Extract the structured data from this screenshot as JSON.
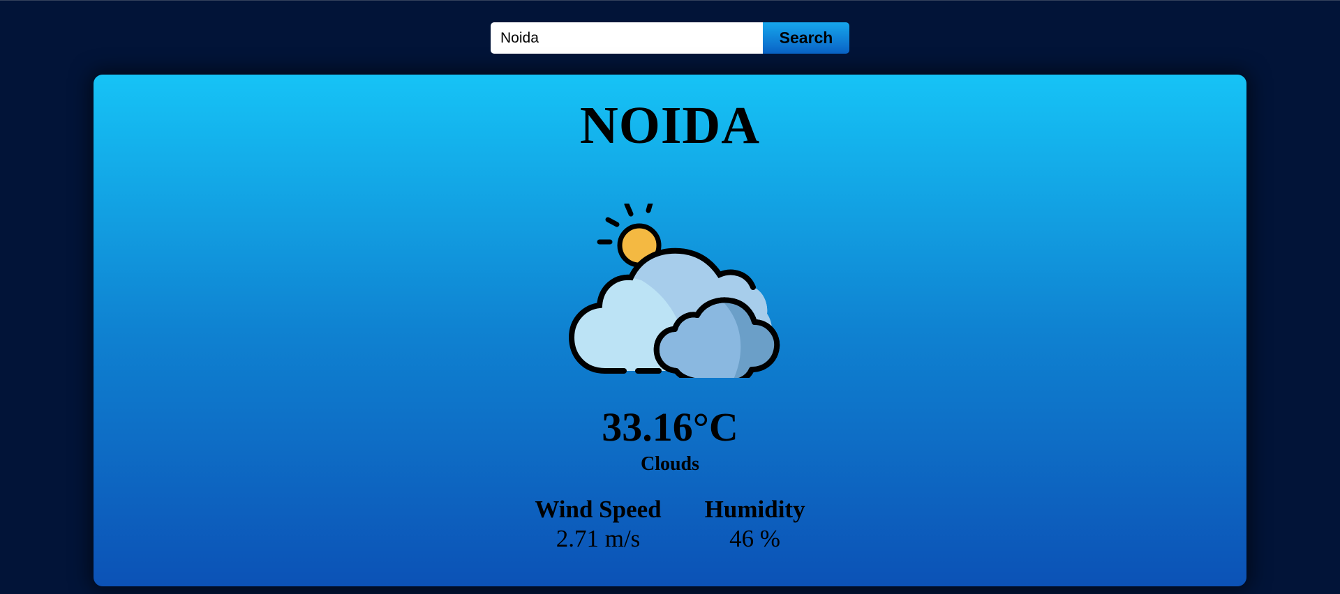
{
  "search": {
    "value": "Noida",
    "button_label": "Search"
  },
  "weather": {
    "city": "NOIDA",
    "temperature": "33.16°C",
    "condition": "Clouds",
    "icon": "sun-behind-clouds-icon",
    "wind_speed": {
      "label": "Wind Speed",
      "value": "2.71 m/s"
    },
    "humidity": {
      "label": "Humidity",
      "value": "46 %"
    }
  },
  "colors": {
    "page_background": "#021438",
    "card_gradient_top": "#16c3f6",
    "card_gradient_bottom": "#0c52b6",
    "button_gradient_top": "#16a6ec",
    "button_gradient_bottom": "#0a63c6"
  }
}
